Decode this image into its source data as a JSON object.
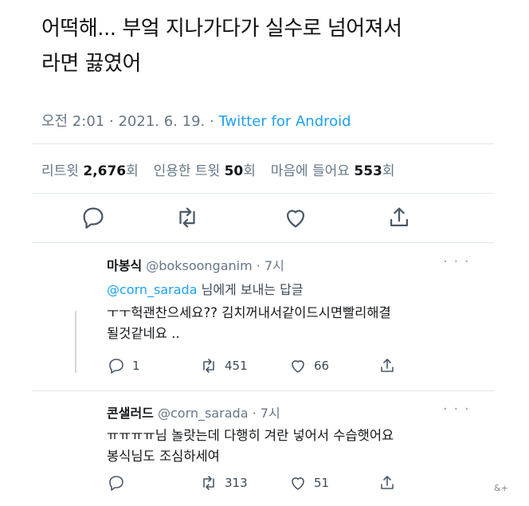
{
  "tweet": {
    "text_line1": "어떡해... 부엌 지나가다가 실수로 넘어져서",
    "text_line2": "라면 끓였어",
    "time": "오전 2:01",
    "date": "2021. 6. 19.",
    "separator": "·",
    "source": "Twitter for Android",
    "stats": {
      "retweets_label": "리트윗",
      "retweets": "2,676",
      "retweets_unit": "회",
      "quotes_label": "인용한 트윗",
      "quotes": "50",
      "quotes_unit": "회",
      "likes_label": "마음에 들어요",
      "likes": "553",
      "likes_unit": "회"
    }
  },
  "replies": [
    {
      "name": "마봉식",
      "handle": "@boksoonganim",
      "time": "· 7시",
      "reply_to_handle": "@corn_sarada",
      "reply_to_suffix": "님에게 보내는 답글",
      "text_line1": "ㅜㅜ헉괜찬으세요?? 김치꺼내서같이드시면빨리해결",
      "text_line2": "될것같네요 ..",
      "replies_count": "1",
      "retweets_count": "451",
      "likes_count": "66"
    },
    {
      "name": "콘샐러드",
      "handle": "@corn_sarada",
      "time": "· 7시",
      "text_line1": "ㅠㅠㅠㅠ님 놀랏는데 다행히 겨란 넣어서 수습햇어요",
      "text_line2": "봉식님도 조심하세여",
      "replies_count": "",
      "retweets_count": "313",
      "likes_count": "51"
    }
  ],
  "more_glyph": "· · ·",
  "watermark": "&+",
  "icons": [
    "reply-icon",
    "retweet-icon",
    "like-icon",
    "share-icon"
  ]
}
